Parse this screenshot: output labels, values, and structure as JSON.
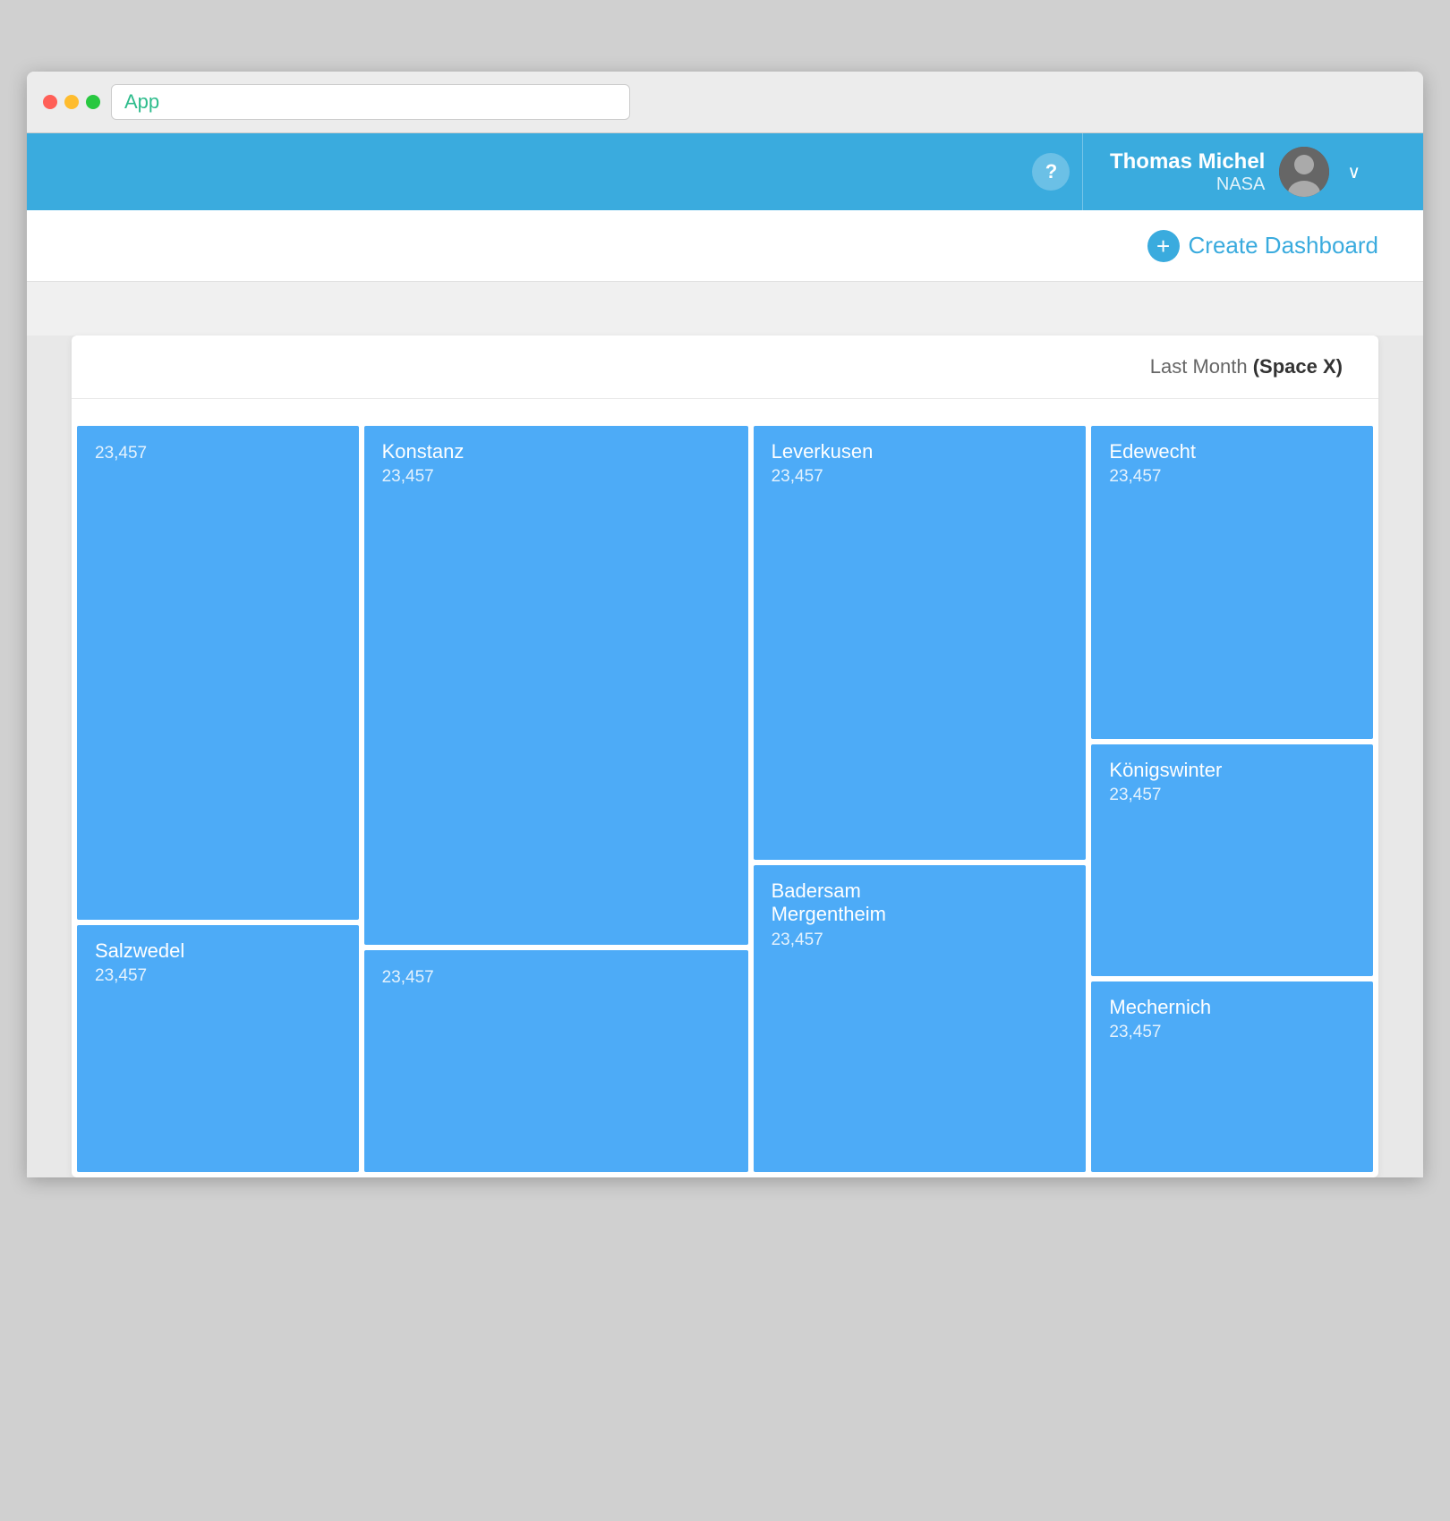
{
  "window": {
    "address_bar_text": "App"
  },
  "navbar": {
    "help_icon": "?",
    "user": {
      "name": "Thomas Michel",
      "org": "NASA",
      "chevron": "∨"
    }
  },
  "subheader": {
    "create_btn_label": "Create Dashboard",
    "create_icon": "+"
  },
  "dashboard": {
    "filter_label": "Last Month",
    "filter_paren": "(Space X)",
    "treemap": {
      "cells": [
        {
          "id": "col1_r1",
          "col": 0,
          "name": "",
          "value": "23,457",
          "flex": 1.7
        },
        {
          "id": "col1_r2",
          "col": 0,
          "name": "Salzwedel",
          "value": "23,457",
          "flex": 0.7
        },
        {
          "id": "col2_r1",
          "col": 1,
          "name": "Konstanz",
          "value": "23,457",
          "flex": 1.9
        },
        {
          "id": "col2_r2",
          "col": 1,
          "name": "",
          "value": "23,457",
          "flex": 0.8
        },
        {
          "id": "col3_r1",
          "col": 2,
          "name": "Leverkusen",
          "value": "23,457",
          "flex": 1.6
        },
        {
          "id": "col3_r2",
          "col": 2,
          "name": "Badersam Mergentheim",
          "value": "23,457",
          "flex": 1.2
        },
        {
          "id": "col4_r1",
          "col": 3,
          "name": "Edewecht",
          "value": "23,457",
          "flex": 1.3
        },
        {
          "id": "col4_r2",
          "col": 3,
          "name": "Königswinter",
          "value": "23,457",
          "flex": 1.0
        },
        {
          "id": "col4_r3",
          "col": 3,
          "name": "Mechernich",
          "value": "23,457",
          "flex": 0.8
        }
      ]
    }
  },
  "colors": {
    "navbar_bg": "#3aabde",
    "treemap_cell": "#4dabf7",
    "accent": "#3aabde"
  }
}
